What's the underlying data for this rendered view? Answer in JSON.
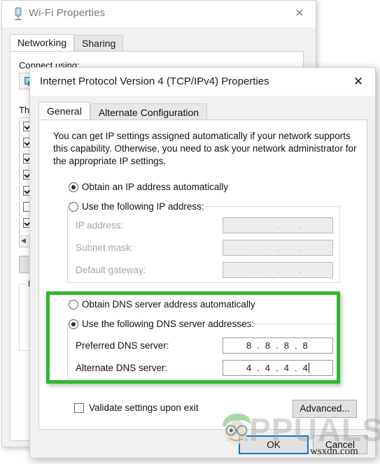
{
  "background_window": {
    "title": "Wi-Fi Properties",
    "title_icon": "network-adapter-icon",
    "close_icon": "✕",
    "tabs": [
      {
        "label": "Networking",
        "active": true
      },
      {
        "label": "Sharing",
        "active": false
      }
    ],
    "connect_label": "Connect using:",
    "items_label": "This connection uses the following items:",
    "description_label": "Description"
  },
  "dialog": {
    "title": "Internet Protocol Version 4 (TCP/IPv4) Properties",
    "close_icon": "✕",
    "tabs": [
      {
        "label": "General",
        "active": true
      },
      {
        "label": "Alternate Configuration",
        "active": false
      }
    ],
    "intro": "You can get IP settings assigned automatically if your network supports this capability. Otherwise, you need to ask your network administrator for the appropriate IP settings.",
    "ip_options": {
      "auto_label": "Obtain an IP address automatically",
      "auto_selected": true,
      "manual_label": "Use the following IP address:",
      "manual_selected": false,
      "fields": [
        {
          "label": "IP address:",
          "value": ".   .   .",
          "disabled": true
        },
        {
          "label": "Subnet mask:",
          "value": ".   .   .",
          "disabled": true
        },
        {
          "label": "Default gateway:",
          "value": ".   .   .",
          "disabled": true
        }
      ]
    },
    "dns_options": {
      "auto_label": "Obtain DNS server address automatically",
      "auto_selected": false,
      "manual_label": "Use the following DNS server addresses:",
      "manual_selected": true,
      "fields": [
        {
          "label": "Preferred DNS server:",
          "value": "8 . 8 . 8 . 8",
          "disabled": false
        },
        {
          "label": "Alternate DNS server:",
          "value": "4 . 4 . 4 . 4",
          "disabled": false,
          "caret": true
        }
      ],
      "highlight_color": "#2eb82e"
    },
    "validate_checkbox": {
      "label": "Validate settings upon exit",
      "checked": false
    },
    "buttons": {
      "advanced": "Advanced...",
      "ok": "OK",
      "cancel": "Cancel",
      "ok_focus_color": "#0078d7"
    }
  },
  "watermark": {
    "brand": "APPUALS",
    "source": "wsxdn.com"
  }
}
